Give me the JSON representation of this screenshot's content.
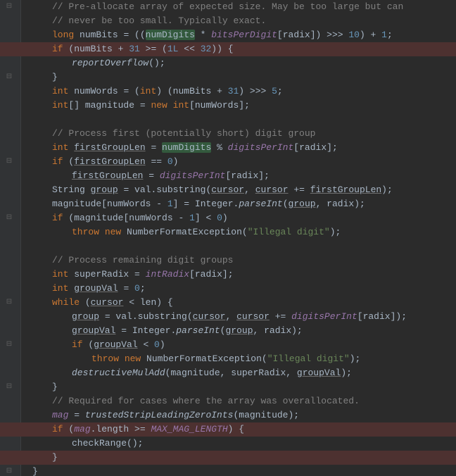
{
  "code": {
    "c_prealloc1": "// Pre-allocate array of expected size. May be too large but can",
    "c_prealloc2": "// never be too small. Typically exact.",
    "kw_long": "long",
    "kw_int": "int",
    "kw_if": "if",
    "kw_new": "new",
    "kw_while": "while",
    "kw_throw": "throw",
    "v_numBits": "numBits",
    "v_numDigits": "numDigits",
    "v_bitsPerDigit": "bitsPerDigit",
    "v_radix": "radix",
    "v_numWords": "numWords",
    "v_magnitude": "magnitude",
    "v_firstGroupLen": "firstGroupLen",
    "v_digitsPerInt": "digitsPerInt",
    "v_group": "group",
    "v_val": "val",
    "v_cursor": "cursor",
    "v_len": "len",
    "v_superRadix": "superRadix",
    "v_intRadix": "intRadix",
    "v_groupVal": "groupVal",
    "v_mag": "mag",
    "v_MAX_MAG_LENGTH": "MAX_MAG_LENGTH",
    "fn_reportOverflow": "reportOverflow",
    "fn_substring": "substring",
    "fn_parseInt": "parseInt",
    "fn_NFE": "NumberFormatException",
    "fn_destructiveMulAdd": "destructiveMulAdd",
    "fn_trustedStrip": "trustedStripLeadingZeroInts",
    "fn_checkRange": "checkRange",
    "cls_String": "String",
    "cls_Integer": "Integer",
    "n_10": "10",
    "n_1": "1",
    "n_31": "31",
    "n_1L": "1L",
    "n_32": "32",
    "n_5": "5",
    "n_0": "0",
    "s_illegal": "\"Illegal digit\"",
    "c_first": "// Process first (potentially short) digit group",
    "c_remaining": "// Process remaining digit groups",
    "c_required": "// Required for cases where the array was overallocated.",
    "p_eq": " = ",
    "p_assign_expr1": " (((",
    "p_mul": " * ",
    "p_br_open": "[",
    "p_br_close": "]",
    "p_paren2_shr": "]) >>> ",
    "p_close_plus": ") + ",
    "p_semi": ";",
    "p_if_open": " (",
    "p_plus": " + ",
    "p_ge": " >= (",
    "p_shl": " << ",
    "p_close2_brace": ")) {",
    "p_parens_semi": "();",
    "p_close_brace": "}",
    "p_cast": " = (",
    "p_cast_close": ") (",
    "p_shr2": ") >>> ",
    "p_arr": "[] ",
    "p_mod": " % ",
    "p_eqeq": " == ",
    "p_close_paren": ")",
    "p_dot": ".",
    "p_comma": ", ",
    "p_pluseq": " += ",
    "p_close_paren_semi": ");",
    "p_minus": " - ",
    "p_lt": " < ",
    "p_open_brace": " {",
    "p_close_paren_brace": ") {",
    "p_lenprop": ".length"
  },
  "fold_glyph": "⊟"
}
